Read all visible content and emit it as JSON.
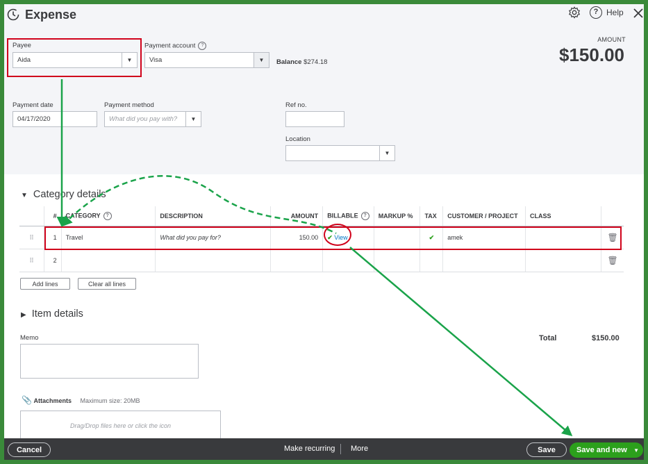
{
  "header": {
    "title": "Expense",
    "help_label": "Help"
  },
  "payee": {
    "label": "Payee",
    "value": "Aida"
  },
  "payment_account": {
    "label": "Payment account",
    "value": "Visa",
    "balance_label": "Balance",
    "balance_value": "$274.18"
  },
  "amount": {
    "label": "AMOUNT",
    "value": "$150.00"
  },
  "payment_date": {
    "label": "Payment date",
    "value": "04/17/2020"
  },
  "payment_method": {
    "label": "Payment method",
    "placeholder": "What did you pay with?"
  },
  "ref_no": {
    "label": "Ref no.",
    "value": ""
  },
  "location": {
    "label": "Location",
    "value": ""
  },
  "category_details": {
    "heading": "Category details",
    "columns": {
      "num": "#",
      "category": "CATEGORY",
      "description": "DESCRIPTION",
      "amount": "AMOUNT",
      "billable": "BILLABLE",
      "markup": "MARKUP %",
      "tax": "TAX",
      "customer": "CUSTOMER / PROJECT",
      "class": "CLASS"
    },
    "rows": [
      {
        "num": "1",
        "category": "Travel",
        "description_placeholder": "What did you pay for?",
        "amount": "150.00",
        "billable_link": "View",
        "billable_checked": true,
        "tax_checked": true,
        "customer": "amek"
      },
      {
        "num": "2"
      }
    ],
    "add_lines": "Add lines",
    "clear_all_lines": "Clear all lines"
  },
  "item_details": {
    "heading": "Item details"
  },
  "memo": {
    "label": "Memo"
  },
  "total": {
    "label": "Total",
    "value": "$150.00"
  },
  "attachments": {
    "label": "Attachments",
    "max_size": "Maximum size: 20MB",
    "dropzone": "Drag/Drop files here or click the icon"
  },
  "footer": {
    "cancel": "Cancel",
    "make_recurring": "Make recurring",
    "more": "More",
    "save": "Save",
    "save_and_new": "Save and new"
  },
  "colors": {
    "annotation_red": "#d0021b",
    "annotation_green": "#1aa34a",
    "primary_green": "#2ca01c",
    "footer_bg": "#393a3d",
    "border_green": "#3a8a3a"
  }
}
